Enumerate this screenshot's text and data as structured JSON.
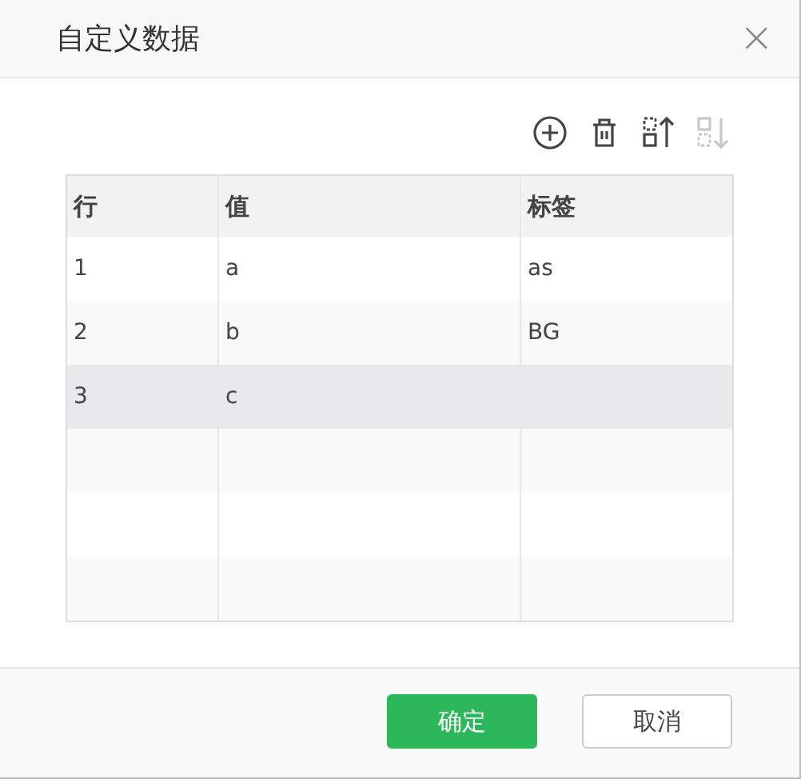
{
  "dialog": {
    "title": "自定义数据",
    "close": "×"
  },
  "toolbar": [
    {
      "kind": "add",
      "disabled": false
    },
    {
      "kind": "delete",
      "disabled": false
    },
    {
      "kind": "move-up",
      "disabled": false
    },
    {
      "kind": "move-down",
      "disabled": true
    }
  ],
  "table": {
    "columns": [
      "行",
      "值",
      "标签"
    ],
    "rows": [
      {
        "cells": [
          "1",
          "a",
          "as"
        ],
        "selected": false
      },
      {
        "cells": [
          "2",
          "b",
          "BG"
        ],
        "selected": false
      },
      {
        "cells": [
          "3",
          "c"
        ],
        "selected": true
      }
    ]
  },
  "buttons": [
    {
      "label": "确定",
      "kind": "primary"
    },
    {
      "label": "取消",
      "kind": "secondary"
    }
  ]
}
